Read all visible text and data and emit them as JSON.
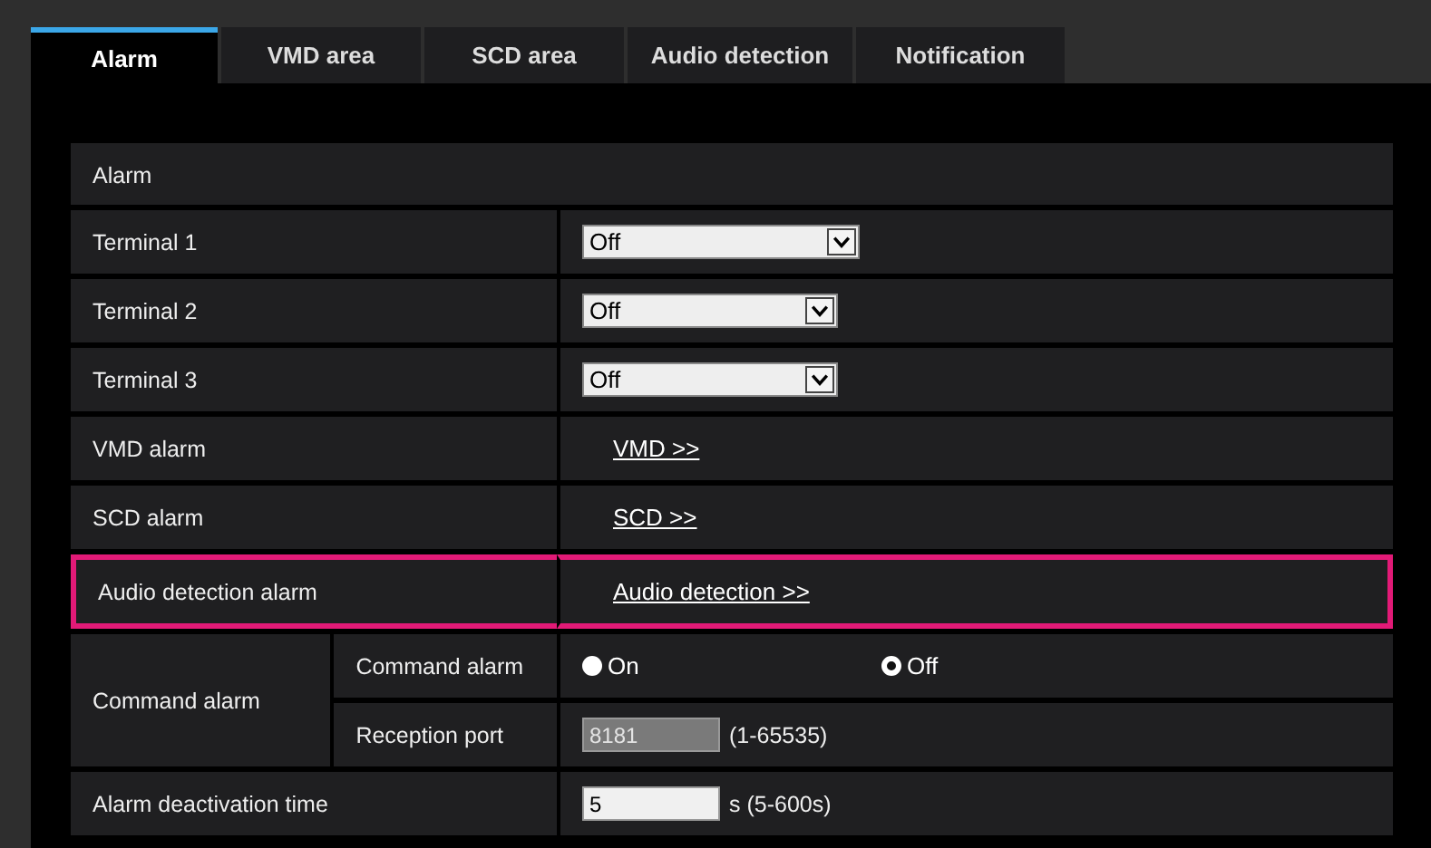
{
  "tabs": [
    {
      "label": "Alarm",
      "selected": true
    },
    {
      "label": "VMD area",
      "selected": false
    },
    {
      "label": "SCD area",
      "selected": false
    },
    {
      "label": "Audio detection",
      "selected": false
    },
    {
      "label": "Notification",
      "selected": false
    }
  ],
  "section_title": "Alarm",
  "rows": [
    {
      "kind": "select",
      "label": "Terminal 1",
      "value": "Off",
      "wide": true,
      "highlighted": false
    },
    {
      "kind": "select",
      "label": "Terminal 2",
      "value": "Off",
      "wide": false,
      "highlighted": false
    },
    {
      "kind": "select",
      "label": "Terminal 3",
      "value": "Off",
      "wide": false,
      "highlighted": false
    },
    {
      "kind": "link",
      "label": "VMD alarm",
      "link": "VMD >>",
      "highlighted": false
    },
    {
      "kind": "link",
      "label": "SCD alarm",
      "link": "SCD >>",
      "highlighted": false
    },
    {
      "kind": "link",
      "label": "Audio detection alarm",
      "link": "Audio detection >>",
      "highlighted": true
    }
  ],
  "command_alarm": {
    "label": "Command alarm",
    "sub_label": "Command alarm",
    "options": [
      {
        "label": "On",
        "selected": false
      },
      {
        "label": "Off",
        "selected": true
      }
    ],
    "port_label": "Reception port",
    "port_value": "8181",
    "port_disabled": true,
    "port_range": "(1-65535)"
  },
  "deactivation": {
    "label": "Alarm deactivation time",
    "value": "5",
    "range": "s (5-600s)"
  }
}
